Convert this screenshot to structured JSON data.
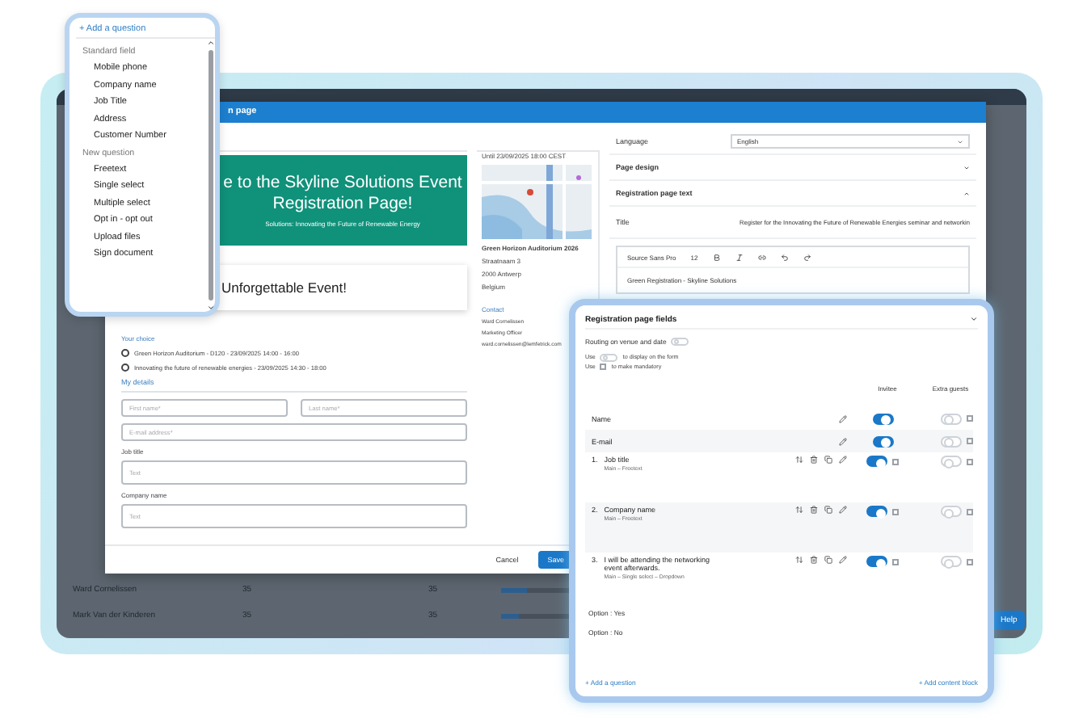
{
  "background_app": {
    "rows": [
      {
        "name": "Ward Cornelissen",
        "column_2": "35",
        "column_3": "35",
        "level": 0.35
      },
      {
        "name": "Mark Van der Kinderen",
        "column_2": "35",
        "column_3": "35",
        "level": 0.25
      }
    ],
    "help_button": "Help"
  },
  "dialog": {
    "title": "n page",
    "preview": {
      "hero_title": "e to the Skyline Solutions Event Registration Page!",
      "hero_subtitle": "Solutions: Innovating the Future of Renewable Energy",
      "card_title": "Unforgettable Event!",
      "choice_label": "Your choice",
      "choices": [
        {
          "label": "Green Horizon Auditorium - D120 - 23/09/2025 14:00 - 16:00",
          "selected": false
        },
        {
          "label": "Innovating the future of renewable energies - 23/09/2025 14:30 - 18:00",
          "selected": false
        }
      ],
      "section": "My details",
      "fields": [
        {
          "kind": "pair",
          "items": [
            {
              "placeholder": "First name*"
            },
            {
              "placeholder": "Last name*"
            }
          ]
        },
        {
          "kind": "single",
          "placeholder": "E-mail address*"
        },
        {
          "kind": "labeled",
          "label": "Job title",
          "placeholder": "Text"
        },
        {
          "kind": "labeled",
          "label": "Company name",
          "placeholder": "Text"
        }
      ]
    },
    "info": {
      "deadline": "Until 23/09/2025 18:00 CEST",
      "venue": "Green Horizon Auditorium 2026",
      "address": [
        "Straatnaam 3",
        "2000 Antwerp",
        "Belgium"
      ],
      "contact_heading": "Contact",
      "contact": [
        "Ward Cornelissen",
        "Marketing Officer",
        "ward.cornelissen@lemfetrick.com"
      ]
    },
    "settings": {
      "language_label": "Language",
      "language": "English",
      "sections": [
        {
          "title": "Page design",
          "expanded": false
        },
        {
          "title": "Registration page text",
          "expanded": true
        }
      ],
      "title_label": "Title",
      "title_value": "Register for the Innovating the Future of Renewable Energies seminar and networkin",
      "editor": {
        "font": "Source Sans Pro",
        "size": "12",
        "content": "Green Registration - Skyline Solutions"
      }
    },
    "buttons": [
      "Cancel",
      "Save"
    ]
  },
  "dropdown": {
    "trigger": "+ Add a question",
    "groups": [
      {
        "heading": "Standard field",
        "items": [
          "Mobile phone",
          "Company name",
          "Job Title",
          "Address",
          "Customer Number"
        ]
      },
      {
        "heading": "New question",
        "items": [
          "Freetext",
          "Single select",
          "Multiple select",
          "Opt in - opt out",
          "Upload files",
          "Sign document"
        ]
      }
    ]
  },
  "fields_panel": {
    "title": "Registration page fields",
    "routing_label": "Routing on venue and date",
    "routing_on": false,
    "legend": [
      {
        "kind": "toggle",
        "before": "Use",
        "after": "to display on the form"
      },
      {
        "kind": "checkbox",
        "before": "Use",
        "after": "to make mandatory"
      }
    ],
    "columns": [
      "Invitee",
      "Extra guests"
    ],
    "rows": [
      {
        "kind": "fixed",
        "label": "Name",
        "invitee_on": true,
        "guests_on": false,
        "guests_mandatory": false
      },
      {
        "kind": "fixed",
        "label": "E-mail",
        "invitee_on": true,
        "guests_on": false,
        "guests_mandatory": false
      },
      {
        "kind": "question",
        "number": "1.",
        "label": "Job title",
        "meta": "Main – Freetext",
        "invitee_on": true,
        "mandatory": false,
        "guests_on": false,
        "guests_mandatory": false
      },
      {
        "kind": "question",
        "number": "2.",
        "label": "Company name",
        "meta": "Main – Freetext",
        "invitee_on": true,
        "mandatory": false,
        "guests_on": false,
        "guests_mandatory": false
      },
      {
        "kind": "question",
        "number": "3.",
        "label": "I will be attending the networking event afterwards.",
        "meta": "Main – Single select – Dropdown",
        "invitee_on": true,
        "mandatory": false,
        "guests_on": false,
        "guests_mandatory": false
      },
      {
        "kind": "option",
        "label": "Option : Yes"
      },
      {
        "kind": "option",
        "label": "Option : No"
      }
    ],
    "add_question": "+ Add a question",
    "add_block": "+ Add content block"
  }
}
